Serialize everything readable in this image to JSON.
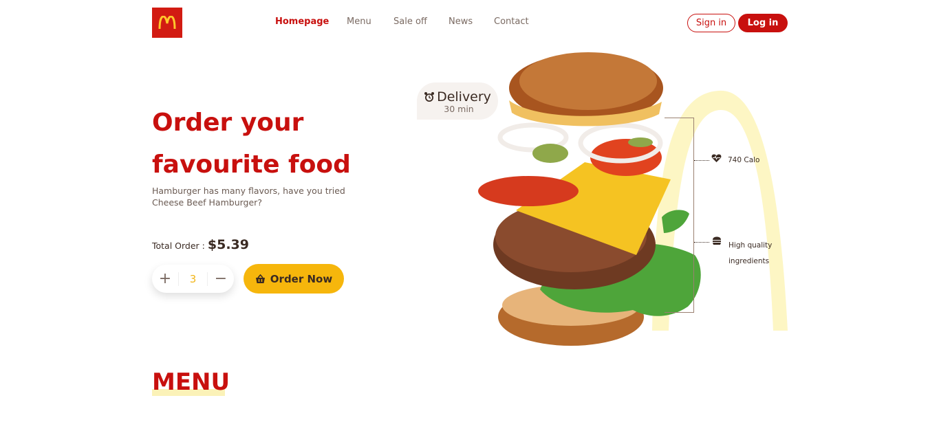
{
  "header": {
    "logo_icon": "golden-arches-logo",
    "nav": [
      "Homepage",
      "Menu",
      "Sale off",
      "News",
      "Contact"
    ],
    "active_nav": "Homepage",
    "signin_label": "Sign in",
    "login_label": "Log in"
  },
  "hero": {
    "title_line1": "Order your",
    "title_line2": "favourite food",
    "description_line1": "Hamburger has many flavors, have you tried",
    "description_line2": "Cheese Beef Hamburger?",
    "total_label": "Total Order :",
    "total_price": "$5.39",
    "quantity": "3",
    "plus_symbol": "+",
    "minus_symbol": "−",
    "order_label": "Order Now"
  },
  "delivery": {
    "title": "Delivery",
    "time": "30 min"
  },
  "features": {
    "calories": "740 Calo",
    "quality_line1": "High quality",
    "quality_line2": "ingredients"
  },
  "sections": {
    "menu_title": "MENU"
  },
  "colors": {
    "brand_red": "#c8100e",
    "brand_yellow": "#f6b60c",
    "arch_yellow": "#fdf6c4"
  }
}
